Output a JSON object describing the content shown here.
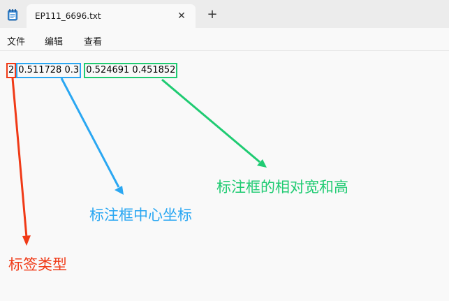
{
  "tab": {
    "title": "EP111_6696.txt",
    "close_glyph": "✕",
    "new_tab_glyph": "+"
  },
  "menu": {
    "items": [
      "文件",
      "编辑",
      "查看"
    ]
  },
  "content": {
    "class_id": "2",
    "center": "0.511728 0.3",
    "size": "0.524691 0.451852"
  },
  "annotations": {
    "size": "标注框的相对宽和高",
    "center": "标注框中心坐标",
    "class": "标签类型"
  },
  "colors": {
    "red": "#f03a17",
    "blue": "#2aa7f2",
    "green": "#1fcb72"
  },
  "icons": {
    "app": "notepad-icon"
  }
}
